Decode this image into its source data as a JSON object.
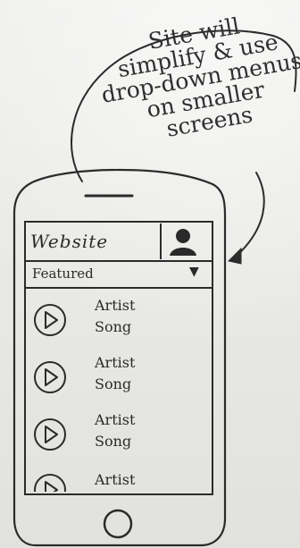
{
  "annotation": {
    "lines": [
      "Site will",
      "simplify & use",
      "drop-down menus",
      "on smaller",
      "screens"
    ]
  },
  "header": {
    "title": "Website"
  },
  "dropdown": {
    "selected": "Featured",
    "caret": "▼"
  },
  "list": {
    "items": [
      {
        "artist": "Artist",
        "song": "Song"
      },
      {
        "artist": "Artist",
        "song": "Song"
      },
      {
        "artist": "Artist",
        "song": "Song"
      },
      {
        "artist": "Artist",
        "song": ""
      }
    ]
  },
  "icons": {
    "profile": "person-icon",
    "play": "play-icon",
    "home": "home-button-icon"
  },
  "colors": {
    "ink": "#2a2a2a",
    "paper": "#e9e9e7"
  }
}
